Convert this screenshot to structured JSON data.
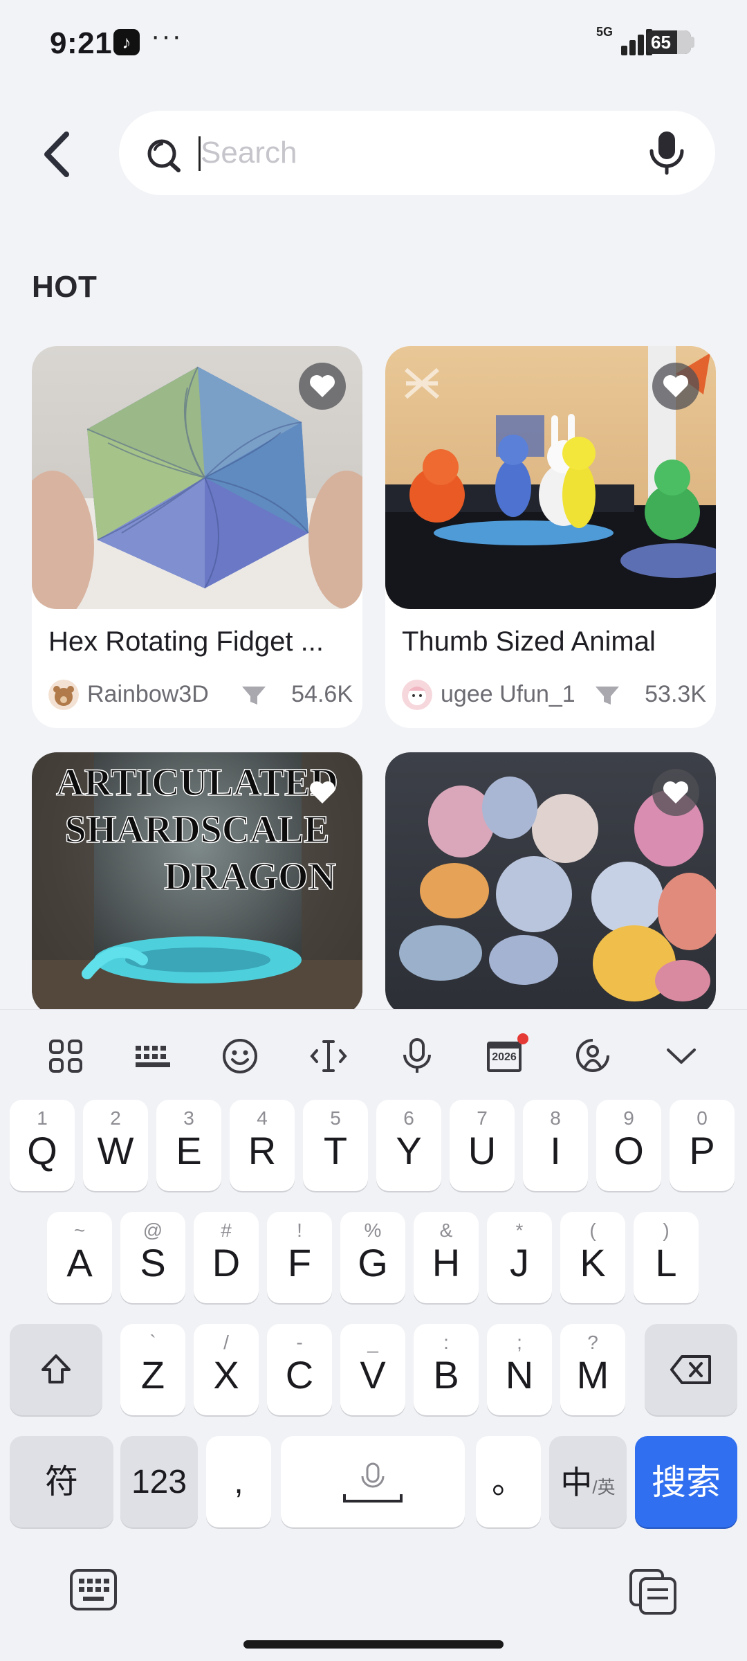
{
  "status_bar": {
    "time": "9:21",
    "more": "···",
    "network": "5G",
    "battery": "65"
  },
  "search": {
    "placeholder": "Search",
    "value": ""
  },
  "section": {
    "title": "HOT"
  },
  "cards": [
    {
      "title": "Hex Rotating Fidget ...",
      "author": "Rainbow3D",
      "downloads": "54.6K"
    },
    {
      "title": "Thumb Sized Animal",
      "author": "ugee Ufun_1",
      "downloads": "53.3K"
    },
    {
      "title": "",
      "image_text": "ARTICULATED SHARDSCALE DRAGON",
      "author": "",
      "downloads": ""
    },
    {
      "title": "",
      "author": "",
      "downloads": ""
    }
  ],
  "keyboard": {
    "toolbar": [
      "apps-grid-icon",
      "keyboard-layout-icon",
      "emoji-icon",
      "cursor-move-icon",
      "voice-icon",
      "calendar-2026-icon",
      "handwriting-icon",
      "collapse-chevron-icon"
    ],
    "toolbar_badge_text": "2026",
    "row1": [
      {
        "main": "Q",
        "hint": "1"
      },
      {
        "main": "W",
        "hint": "2"
      },
      {
        "main": "E",
        "hint": "3"
      },
      {
        "main": "R",
        "hint": "4"
      },
      {
        "main": "T",
        "hint": "5"
      },
      {
        "main": "Y",
        "hint": "6"
      },
      {
        "main": "U",
        "hint": "7"
      },
      {
        "main": "I",
        "hint": "8"
      },
      {
        "main": "O",
        "hint": "9"
      },
      {
        "main": "P",
        "hint": "0"
      }
    ],
    "row2": [
      {
        "main": "A",
        "hint": "~"
      },
      {
        "main": "S",
        "hint": "@"
      },
      {
        "main": "D",
        "hint": "#"
      },
      {
        "main": "F",
        "hint": "!"
      },
      {
        "main": "G",
        "hint": "%"
      },
      {
        "main": "H",
        "hint": "&"
      },
      {
        "main": "J",
        "hint": "*"
      },
      {
        "main": "K",
        "hint": "("
      },
      {
        "main": "L",
        "hint": ")"
      }
    ],
    "row3": [
      {
        "main": "Z",
        "hint": "`"
      },
      {
        "main": "X",
        "hint": "/"
      },
      {
        "main": "C",
        "hint": "-"
      },
      {
        "main": "V",
        "hint": "_"
      },
      {
        "main": "B",
        "hint": ":"
      },
      {
        "main": "N",
        "hint": ";"
      },
      {
        "main": "M",
        "hint": "?"
      }
    ],
    "row4": {
      "symbols": "符",
      "numbers": "123",
      "comma": ",",
      "period": "。",
      "lang_main": "中",
      "lang_sub": "/英",
      "search": "搜索"
    }
  },
  "colors": {
    "accent": "#2f6ff0",
    "background": "#f2f3f7"
  }
}
